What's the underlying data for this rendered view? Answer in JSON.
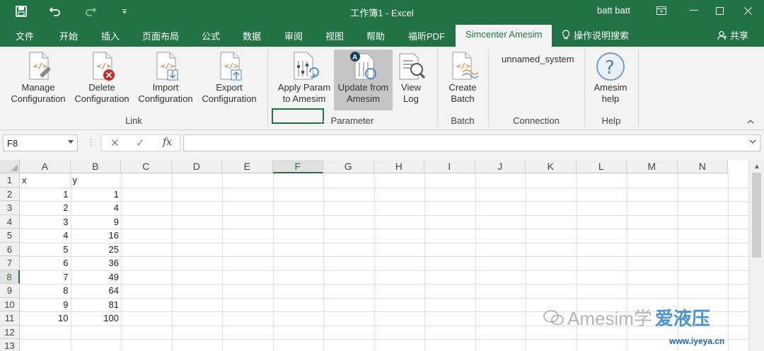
{
  "titlebar": {
    "title": "工作簿1 - Excel",
    "user": "batt batt",
    "save_icon": "save-icon",
    "undo_icon": "undo-icon",
    "redo_icon": "redo-icon",
    "customize_icon": "customize-quick-access-icon"
  },
  "tabs": {
    "items": [
      "文件",
      "开始",
      "插入",
      "页面布局",
      "公式",
      "数据",
      "审阅",
      "视图",
      "帮助",
      "福昕PDF",
      "Simcenter Amesim"
    ],
    "active": "Simcenter Amesim",
    "tell_me": "操作说明搜索",
    "share": "共享"
  },
  "ribbon": {
    "buttons": {
      "manage": "Manage\nConfiguration",
      "delete": "Delete\nConfiguration",
      "import": "Import\nConfiguration",
      "export": "Export\nConfiguration",
      "apply": "Apply Param\nto Amesim",
      "update": "Update from\nAmesim",
      "viewlog": "View\nLog",
      "batch": "Create\nBatch",
      "help": "Amesim\nhelp"
    },
    "system_name": "unnamed_system",
    "groups": {
      "link": "Link",
      "parameter": "Parameter",
      "batch": "Batch",
      "connection": "Connection",
      "help": "Help"
    }
  },
  "formula_bar": {
    "name_box": "F8",
    "cancel_symbol": "✕",
    "enter_symbol": "✓",
    "fx": "fx",
    "formula": ""
  },
  "sheet": {
    "columns": [
      "A",
      "B",
      "C",
      "D",
      "E",
      "F",
      "G",
      "H",
      "I",
      "J",
      "K",
      "L",
      "M",
      "N"
    ],
    "rows": [
      "1",
      "2",
      "3",
      "4",
      "5",
      "6",
      "7",
      "8",
      "9",
      "10",
      "11",
      "12",
      "13"
    ],
    "selected_column": "F",
    "selected_row": "8",
    "headers": {
      "A": "x",
      "B": "y"
    },
    "values": [
      [
        "1",
        "1"
      ],
      [
        "2",
        "4"
      ],
      [
        "3",
        "9"
      ],
      [
        "4",
        "16"
      ],
      [
        "5",
        "25"
      ],
      [
        "6",
        "36"
      ],
      [
        "7",
        "49"
      ],
      [
        "8",
        "64"
      ],
      [
        "9",
        "81"
      ],
      [
        "10",
        "100"
      ]
    ]
  },
  "watermark": {
    "text": "Amesim学",
    "brand": "爱液压",
    "url": "www.iyeya.cn"
  }
}
